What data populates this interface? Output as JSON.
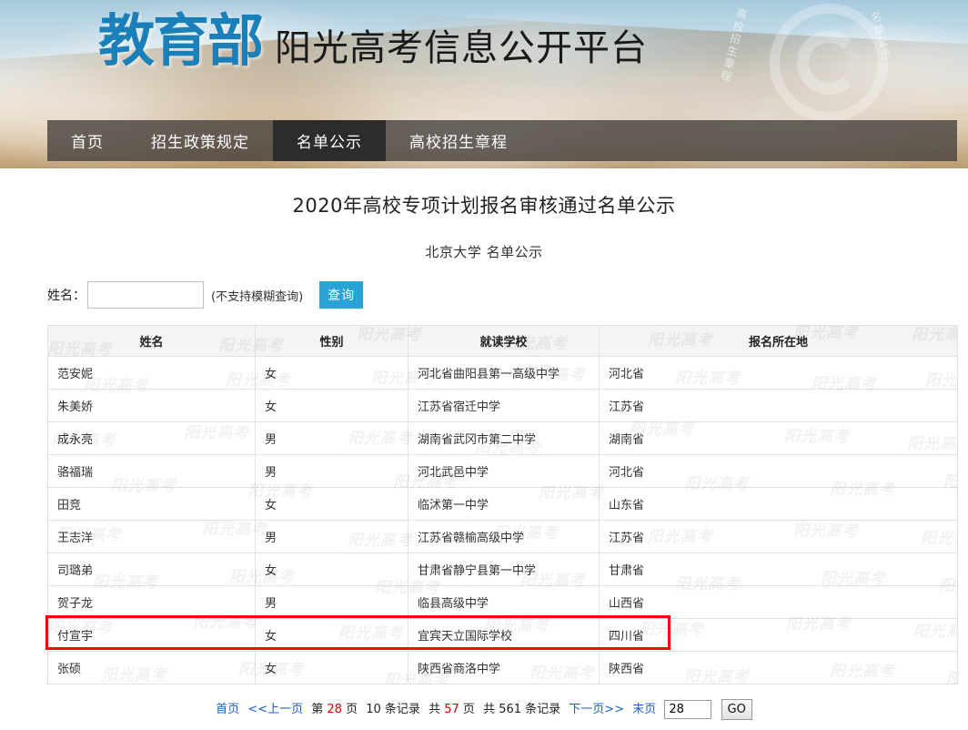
{
  "banner": {
    "logo_main": "教育部",
    "logo_sub": "阳光高考信息公开平台",
    "emblem_text_left": "高校招生章程",
    "emblem_text_right": "名单公示"
  },
  "nav": {
    "items": [
      {
        "label": "首页",
        "active": false
      },
      {
        "label": "招生政策规定",
        "active": false
      },
      {
        "label": "名单公示",
        "active": true
      },
      {
        "label": "高校招生章程",
        "active": false
      }
    ]
  },
  "page": {
    "title": "2020年高校专项计划报名审核通过名单公示",
    "subtitle": "北京大学 名单公示"
  },
  "search": {
    "label": "姓名：",
    "value": "",
    "placeholder": "",
    "hint": "(不支持模糊查询)",
    "button": "查询"
  },
  "table": {
    "headers": [
      "姓名",
      "性别",
      "就读学校",
      "报名所在地"
    ],
    "rows": [
      {
        "name": "范安妮",
        "sex": "女",
        "school": "河北省曲阳县第一高级中学",
        "place": "河北省",
        "highlighted": false
      },
      {
        "name": "朱美娇",
        "sex": "女",
        "school": "江苏省宿迁中学",
        "place": "江苏省",
        "highlighted": false
      },
      {
        "name": "成永亮",
        "sex": "男",
        "school": "湖南省武冈市第二中学",
        "place": "湖南省",
        "highlighted": false
      },
      {
        "name": "骆福瑞",
        "sex": "男",
        "school": "河北武邑中学",
        "place": "河北省",
        "highlighted": false
      },
      {
        "name": "田竞",
        "sex": "女",
        "school": "临沭第一中学",
        "place": "山东省",
        "highlighted": false
      },
      {
        "name": "王志洋",
        "sex": "男",
        "school": "江苏省赣榆高级中学",
        "place": "江苏省",
        "highlighted": false
      },
      {
        "name": "司璐弟",
        "sex": "女",
        "school": "甘肃省静宁县第一中学",
        "place": "甘肃省",
        "highlighted": false
      },
      {
        "name": "贺子龙",
        "sex": "男",
        "school": "临县高级中学",
        "place": "山西省",
        "highlighted": true
      },
      {
        "name": "付宣宇",
        "sex": "女",
        "school": "宜宾天立国际学校",
        "place": "四川省",
        "highlighted": false
      },
      {
        "name": "张硕",
        "sex": "女",
        "school": "陕西省商洛中学",
        "place": "陕西省",
        "highlighted": false
      }
    ]
  },
  "watermark": {
    "text": "阳光高考"
  },
  "pager": {
    "first": "首页",
    "prev": "<<上一页",
    "cur_prefix": "第",
    "cur_page": "28",
    "cur_suffix": "页",
    "per_page": "10 条记录",
    "total_prefix": "共",
    "total_pages": "57",
    "total_suffix": "页",
    "records_prefix": "共 561 条记录",
    "next": "下一页>>",
    "last": "末页",
    "goto_value": "28",
    "go_label": "GO"
  },
  "colors": {
    "logo_blue": "#1b7fba",
    "button_blue": "#29a3d5",
    "highlight_red": "#fb0606",
    "link_blue": "#1a5fc8",
    "accent_red": "#e00000",
    "nav_active": "#2e2c2a"
  }
}
